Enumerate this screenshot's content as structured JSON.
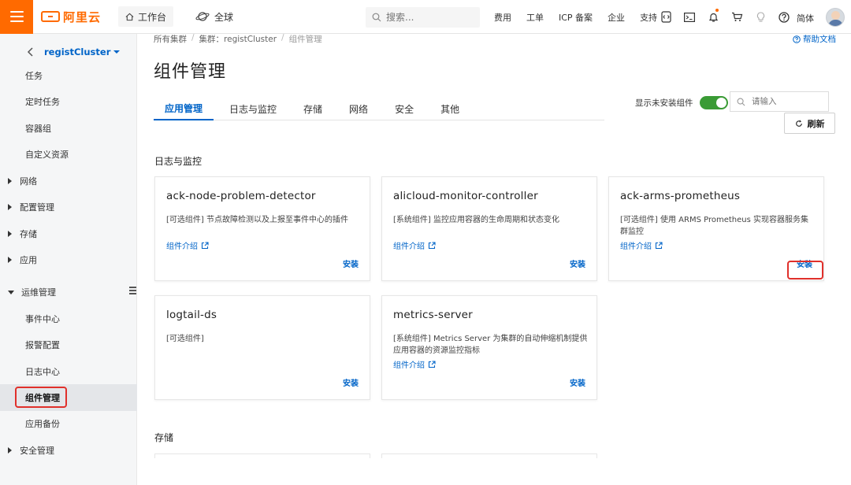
{
  "topbar": {
    "logo_text": "阿里云",
    "workbench": "工作台",
    "global": "全球",
    "search_placeholder": "搜索...",
    "nav": [
      "费用",
      "工单",
      "ICP 备案",
      "企业",
      "支持"
    ],
    "lang": "简体",
    "icons": [
      "code-icon",
      "terminal-icon",
      "bell-icon",
      "cart-icon",
      "bulb-icon",
      "help-icon"
    ]
  },
  "sidebar": {
    "cluster_name": "registCluster",
    "items": [
      {
        "label": "任务",
        "type": "sub"
      },
      {
        "label": "定时任务",
        "type": "sub"
      },
      {
        "label": "容器组",
        "type": "sub"
      },
      {
        "label": "自定义资源",
        "type": "sub"
      },
      {
        "label": "网络",
        "type": "group"
      },
      {
        "label": "配置管理",
        "type": "group"
      },
      {
        "label": "存储",
        "type": "group"
      },
      {
        "label": "应用",
        "type": "group"
      },
      {
        "label": "运维管理",
        "type": "group-open"
      },
      {
        "label": "事件中心",
        "type": "sub"
      },
      {
        "label": "报警配置",
        "type": "sub"
      },
      {
        "label": "日志中心",
        "type": "sub"
      },
      {
        "label": "组件管理",
        "type": "sub-active"
      },
      {
        "label": "应用备份",
        "type": "sub"
      },
      {
        "label": "安全管理",
        "type": "group"
      }
    ]
  },
  "breadcrumb": {
    "all": "所有集群",
    "cluster": "集群：registCluster",
    "current": "组件管理",
    "sep": "/"
  },
  "help_doc": "帮助文档",
  "page_title": "组件管理",
  "tabs": [
    "应用管理",
    "日志与监控",
    "存储",
    "网络",
    "安全",
    "其他"
  ],
  "toolbar": {
    "show_uninstalled": "显示未安装组件",
    "filter_placeholder": "请输入",
    "refresh": "刷新"
  },
  "sections": [
    {
      "title": "日志与监控",
      "cards": [
        {
          "name": "ack-node-problem-detector",
          "desc": "[可选组件] 节点故障检测以及上报至事件中心的插件",
          "link": "组件介绍",
          "action": "安装"
        },
        {
          "name": "alicloud-monitor-controller",
          "desc": "[系统组件] 监控应用容器的生命周期和状态变化",
          "link": "组件介绍",
          "action": "安装"
        },
        {
          "name": "ack-arms-prometheus",
          "desc": "[可选组件] 使用 ARMS Prometheus 实现容器服务集群监控",
          "link": "组件介绍",
          "action": "安装"
        },
        {
          "name": "logtail-ds",
          "desc": "[可选组件]",
          "link": "",
          "action": "安装"
        },
        {
          "name": "metrics-server",
          "desc": "[系统组件] Metrics Server 为集群的自动伸缩机制提供应用容器的资源监控指标",
          "link": "组件介绍",
          "action": "安装"
        }
      ]
    },
    {
      "title": "存储",
      "cards": []
    }
  ],
  "colors": {
    "brand": "#ff6a00",
    "link": "#0064c8",
    "highlight": "#e0302b",
    "toggle_on": "#3a9b35"
  }
}
